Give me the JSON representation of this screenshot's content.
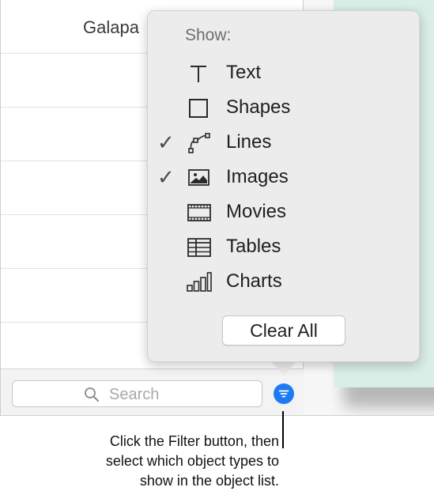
{
  "object_list": {
    "rows": [
      {
        "label": "Galapa"
      },
      {
        "label": ""
      },
      {
        "label": ""
      },
      {
        "label": ""
      },
      {
        "label": ""
      },
      {
        "label": ""
      },
      {
        "label": ""
      }
    ],
    "search": {
      "placeholder": "Search",
      "icon": "search-icon"
    },
    "filter_button": {
      "icon": "filter-icon",
      "color": "#1d7bf2"
    }
  },
  "popover": {
    "heading": "Show:",
    "items": [
      {
        "label": "Text",
        "icon": "text-icon",
        "checked": false
      },
      {
        "label": "Shapes",
        "icon": "shapes-icon",
        "checked": false
      },
      {
        "label": "Lines",
        "icon": "lines-icon",
        "checked": true
      },
      {
        "label": "Images",
        "icon": "images-icon",
        "checked": true
      },
      {
        "label": "Movies",
        "icon": "movies-icon",
        "checked": false
      },
      {
        "label": "Tables",
        "icon": "tables-icon",
        "checked": false
      },
      {
        "label": "Charts",
        "icon": "charts-icon",
        "checked": false
      }
    ],
    "checkmark_glyph": "✓",
    "clear_all_label": "Clear All"
  },
  "canvas": {
    "shape_color": "#d9eee6"
  },
  "callout": {
    "lines": [
      "Click the Filter button, then",
      "select which object types to",
      "show in the object list."
    ]
  }
}
